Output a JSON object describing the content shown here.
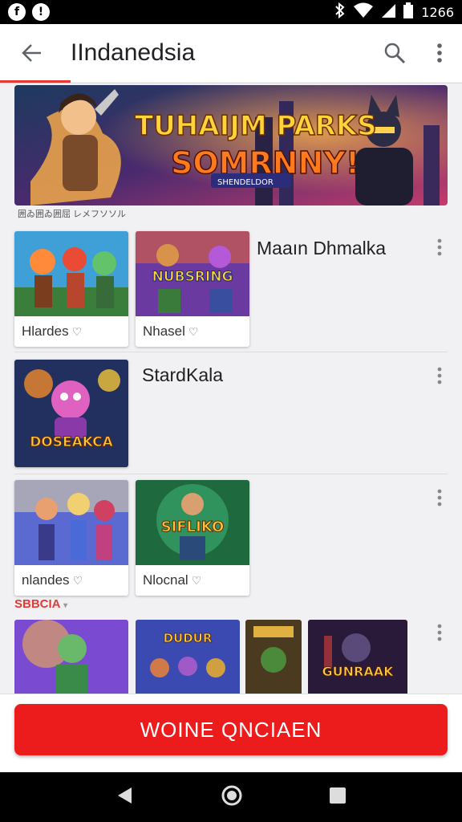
{
  "status_bar": {
    "time": "1266"
  },
  "app_bar": {
    "title": "IIndanedsia"
  },
  "banner": {
    "title_line1": "TUHAIJM PARKS",
    "title_line2": "SOMRNNY!",
    "subtitle": "SHENDELDOR",
    "caption": "囲ゐ囲ゐ囲屈 レメフソソル"
  },
  "sections": [
    {
      "title": "Maaın Dhmalka",
      "cards": [
        {
          "label": "Hlardes",
          "art_text": ""
        },
        {
          "label": "Nhasel",
          "art_text": "NUBSRING"
        }
      ]
    },
    {
      "title": "StardKala",
      "cards": [
        {
          "label": "",
          "art_text": "DOSEAKCA"
        }
      ]
    },
    {
      "title": "",
      "cards": [
        {
          "label": "nlandes",
          "art_text": ""
        },
        {
          "label": "Nlocnal",
          "art_text": "SIFLIKO"
        }
      ]
    },
    {
      "label": "SBBCIA",
      "cards": [
        {
          "art_text": ""
        },
        {
          "art_text": "DUDUR"
        },
        {
          "art_text": ""
        },
        {
          "art_text": "GUNRAAK"
        }
      ]
    }
  ],
  "cta": {
    "label": "WOINE QNCIAEN"
  },
  "colors": {
    "accent": "#ed1c1c",
    "tab_indicator": "#e53935",
    "status_bar": "#000000"
  }
}
